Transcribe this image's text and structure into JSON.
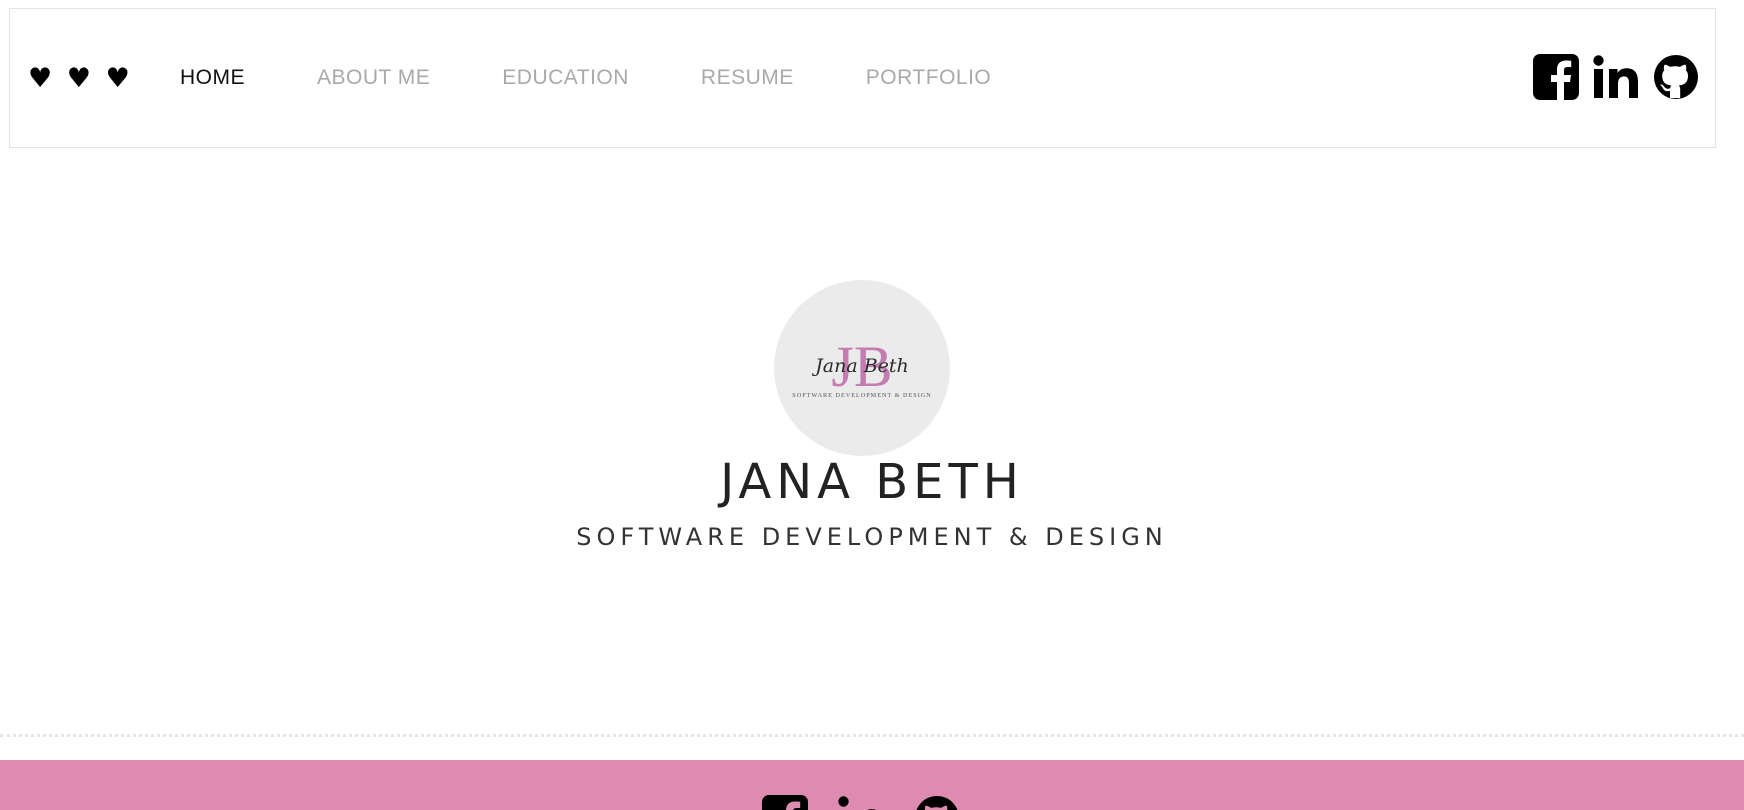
{
  "brand": {
    "text": "♥ ♥ ♥"
  },
  "nav": {
    "items": [
      {
        "label": "HOME",
        "active": true
      },
      {
        "label": "ABOUT ME",
        "active": false
      },
      {
        "label": "EDUCATION",
        "active": false
      },
      {
        "label": "RESUME",
        "active": false
      },
      {
        "label": "PORTFOLIO",
        "active": false
      }
    ],
    "social_icons": [
      "facebook-icon",
      "linkedin-icon",
      "github-icon"
    ]
  },
  "hero": {
    "logo": {
      "initials": "JB",
      "script": "Jana Beth",
      "small_text": "SOFTWARE DEVELOPMENT & DESIGN"
    },
    "name": "JANA BETH",
    "tagline": "SOFTWARE DEVELOPMENT & DESIGN"
  },
  "footer": {
    "social_icons": [
      "facebook-icon",
      "linkedin-icon",
      "github-icon"
    ]
  },
  "colors": {
    "accent_pink": "#dd8bb0",
    "logo_pink": "#c37db0",
    "logo_bg": "#ebebeb",
    "nav_inactive": "#a9a9a9",
    "nav_active": "#111111"
  }
}
